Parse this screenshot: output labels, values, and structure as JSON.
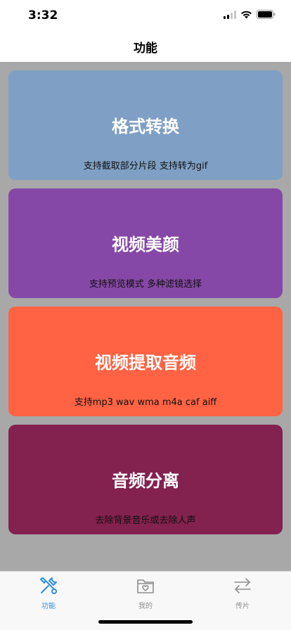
{
  "status": {
    "time": "3:32"
  },
  "nav": {
    "title": "功能"
  },
  "cards": [
    {
      "title": "格式转换",
      "subtitle": "支持截取部分片段 支持转为gif",
      "color": "#7fa0c4"
    },
    {
      "title": "视频美颜",
      "subtitle": "支持预览模式 多种滤镜选择",
      "color": "#8648a6"
    },
    {
      "title": "视频提取音频",
      "subtitle": "支持mp3 wav wma m4a caf aiff",
      "color": "#ff6344"
    },
    {
      "title": "音频分离",
      "subtitle": "去除背景音乐或去除人声",
      "color": "#83214f"
    }
  ],
  "tabs": [
    {
      "label": "功能",
      "icon": "tools-icon",
      "active": true
    },
    {
      "label": "我的",
      "icon": "folder-heart-icon",
      "active": false
    },
    {
      "label": "传片",
      "icon": "transfer-arrows-icon",
      "active": false
    }
  ],
  "colors": {
    "tab_active": "#2f8ee8",
    "tab_inactive": "#8e8e8e",
    "content_bg": "#a8a8a8"
  }
}
